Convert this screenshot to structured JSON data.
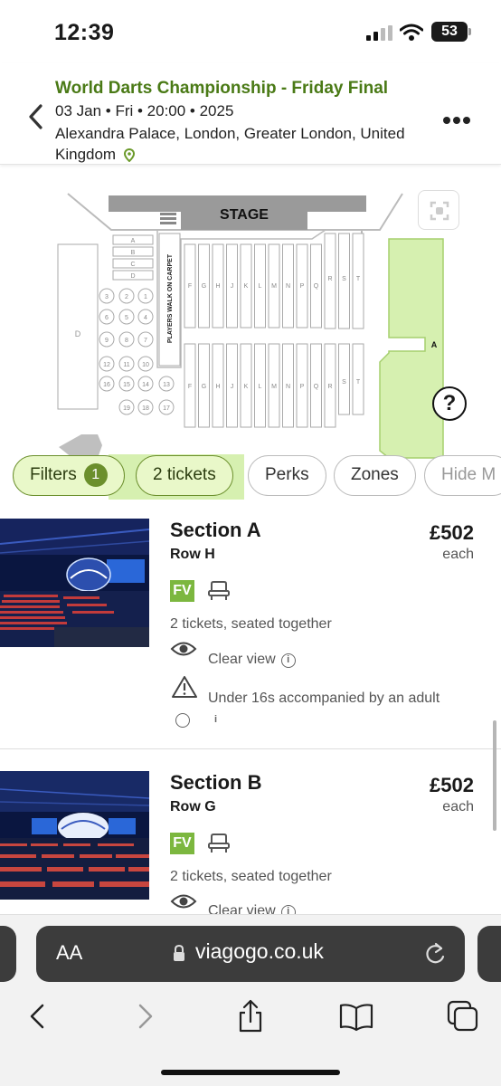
{
  "status_bar": {
    "time": "12:39",
    "battery": "53"
  },
  "event": {
    "title": "World Darts Championship - Friday Final",
    "datetime": "03 Jan • Fri • 20:00 • 2025",
    "venue": "Alexandra Palace, London, Greater London, United Kingdom"
  },
  "map": {
    "stage_label": "STAGE",
    "walk_label": "PLAYERS WALK ON CARPET",
    "left_block_label": "D",
    "right_block_label": "A",
    "front_rows": [
      "A",
      "B",
      "C",
      "D"
    ],
    "tables": [
      "1",
      "2",
      "3",
      "4",
      "5",
      "6",
      "7",
      "8",
      "9",
      "10",
      "11",
      "12",
      "13",
      "14",
      "15",
      "16",
      "17",
      "18",
      "19"
    ],
    "row_columns": [
      "F",
      "G",
      "H",
      "J",
      "K",
      "L",
      "M",
      "N",
      "P",
      "Q",
      "R",
      "S",
      "T"
    ],
    "help_label": "?"
  },
  "filters": {
    "filters_label": "Filters",
    "filters_count": "1",
    "tickets_label": "2 tickets",
    "perks_label": "Perks",
    "zones_label": "Zones",
    "hide_label": "Hide M"
  },
  "listings": [
    {
      "section": "Section A",
      "row": "Row H",
      "price": "£502",
      "price_unit": "each",
      "badge": "FV",
      "seating": "2 tickets, seated together",
      "view": "Clear view",
      "restriction": "Under 16s accompanied by an adult"
    },
    {
      "section": "Section B",
      "row": "Row G",
      "price": "£502",
      "price_unit": "each",
      "badge": "FV",
      "seating": "2 tickets, seated together",
      "view": "Clear view"
    }
  ],
  "browser": {
    "aa_label": "AA",
    "url": "viagogo.co.uk"
  },
  "colors": {
    "brand_green": "#4a7a16",
    "chip_active_bg": "#e9f8c9",
    "badge_green": "#7cb73f",
    "map_highlight": "#d6f0b0"
  }
}
